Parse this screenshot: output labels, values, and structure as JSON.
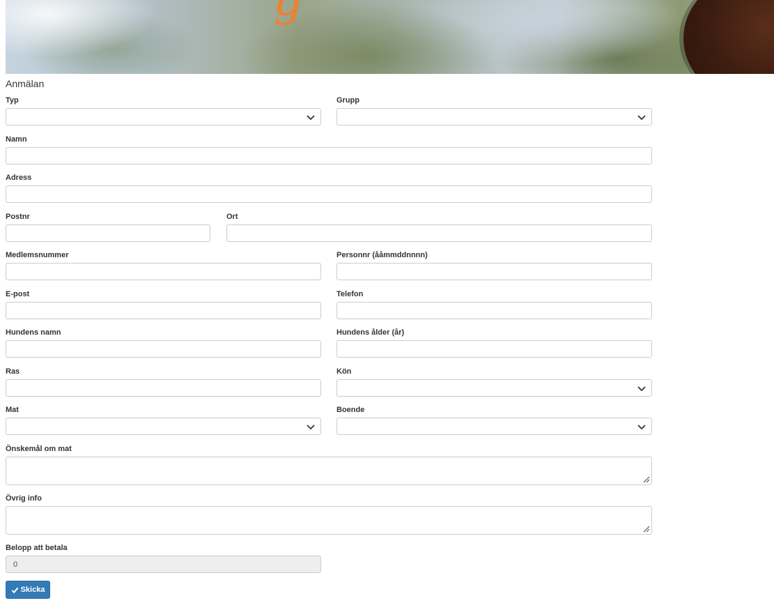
{
  "banner": {
    "letter": "g"
  },
  "form": {
    "title": "Anmälan",
    "fields": {
      "typ": {
        "label": "Typ",
        "value": ""
      },
      "grupp": {
        "label": "Grupp",
        "value": ""
      },
      "namn": {
        "label": "Namn",
        "value": ""
      },
      "adress": {
        "label": "Adress",
        "value": ""
      },
      "postnr": {
        "label": "Postnr",
        "value": ""
      },
      "ort": {
        "label": "Ort",
        "value": ""
      },
      "medlemsnummer": {
        "label": "Medlemsnummer",
        "value": ""
      },
      "personnr": {
        "label": "Personnr (ååmmddnnnn)",
        "value": ""
      },
      "epost": {
        "label": "E-post",
        "value": ""
      },
      "telefon": {
        "label": "Telefon",
        "value": ""
      },
      "hundens_namn": {
        "label": "Hundens namn",
        "value": ""
      },
      "hundens_alder": {
        "label": "Hundens ålder (år)",
        "value": ""
      },
      "ras": {
        "label": "Ras",
        "value": ""
      },
      "kon": {
        "label": "Kön",
        "value": ""
      },
      "mat": {
        "label": "Mat",
        "value": ""
      },
      "boende": {
        "label": "Boende",
        "value": ""
      },
      "onskemal": {
        "label": "Önskemål om mat",
        "value": ""
      },
      "ovrig": {
        "label": "Övrig info",
        "value": ""
      },
      "belopp": {
        "label": "Belopp att betala",
        "value": "0"
      }
    },
    "submit_label": "Skicka"
  },
  "colors": {
    "primary": "#337ab7",
    "border": "#cccccc",
    "readonly_bg": "#eeeeee",
    "banner_accent": "#f07f2e"
  },
  "icons": {
    "select": "chevron-down-icon",
    "textarea": "resize-handle-icon",
    "submit": "check-icon"
  }
}
